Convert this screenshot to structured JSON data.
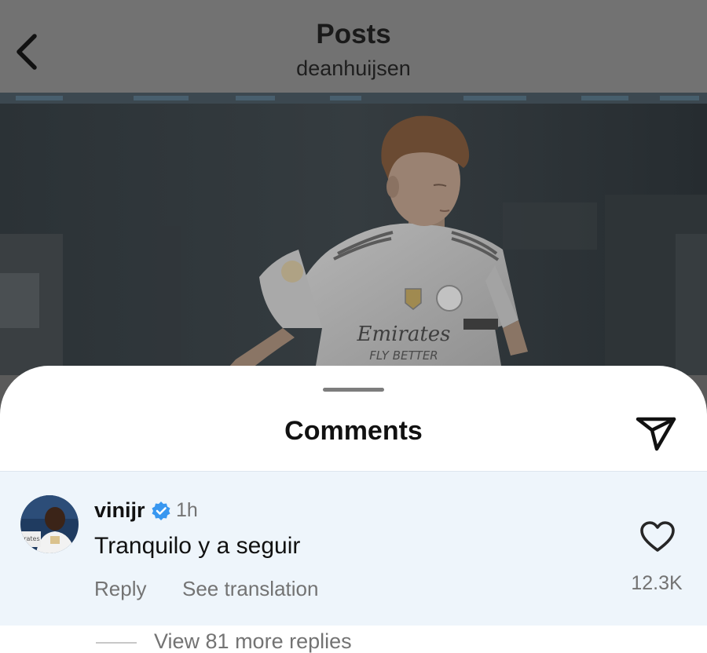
{
  "header": {
    "title": "Posts",
    "username": "deanhuijsen",
    "back_icon": "chevron-left-icon"
  },
  "post_photo": {
    "shirt_sponsor_line1": "Emirates",
    "shirt_sponsor_line2": "FLY BETTER"
  },
  "comments_sheet": {
    "title": "Comments",
    "share_icon": "paper-plane-icon",
    "comments": [
      {
        "username": "vinijr",
        "verified": true,
        "time": "1h",
        "text": "Tranquilo y a seguir",
        "reply_label": "Reply",
        "translate_label": "See translation",
        "like_count": "12.3K",
        "like_icon": "heart-outline-icon",
        "more_replies_label": "View 81 more replies"
      }
    ]
  },
  "colors": {
    "header_bg": "#727272",
    "sheet_bg": "#ffffff",
    "comment_highlight": "#eef5fb",
    "verified_blue": "#3897f0",
    "secondary_text": "#737373"
  }
}
